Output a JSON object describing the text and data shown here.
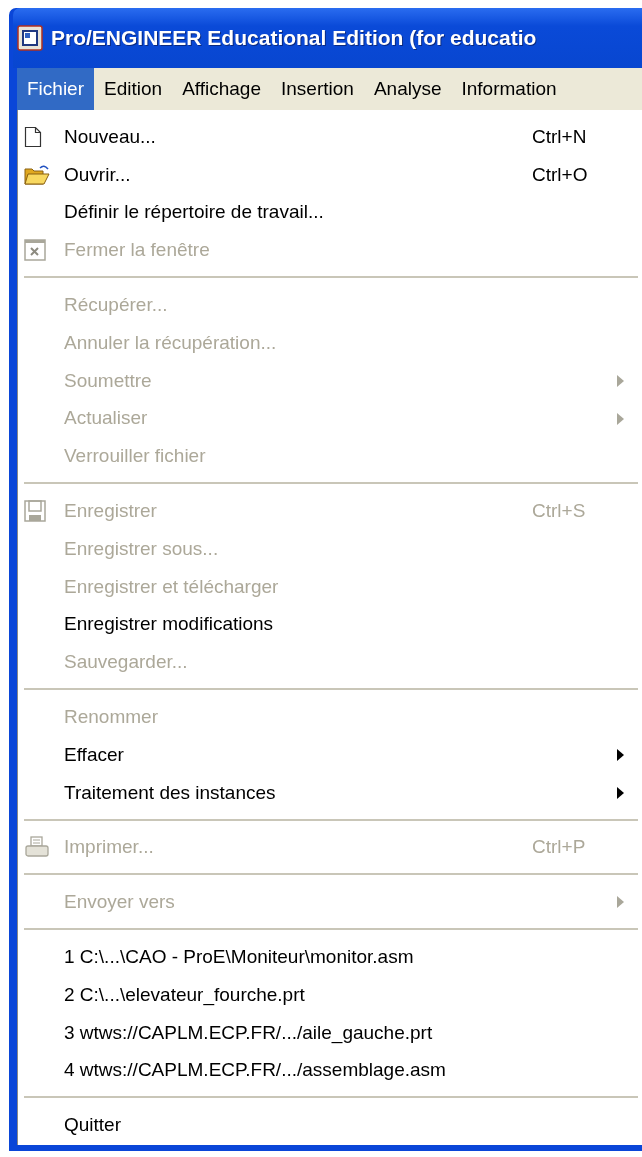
{
  "window": {
    "title": "Pro/ENGINEER Educational Edition (for educatio"
  },
  "menubar": [
    {
      "label": "Fichier",
      "selected": true
    },
    {
      "label": "Edition",
      "selected": false
    },
    {
      "label": "Affichage",
      "selected": false
    },
    {
      "label": "Insertion",
      "selected": false
    },
    {
      "label": "Analyse",
      "selected": false
    },
    {
      "label": "Information",
      "selected": false
    }
  ],
  "menu": [
    {
      "kind": "item",
      "label": "Nouveau...",
      "shortcut": "Ctrl+N",
      "disabled": false
    },
    {
      "kind": "item",
      "label": "Ouvrir...",
      "shortcut": "Ctrl+O",
      "disabled": false
    },
    {
      "kind": "item",
      "label": "Définir le répertoire de travail...",
      "disabled": false
    },
    {
      "kind": "item",
      "label": "Fermer la fenêtre",
      "disabled": true
    },
    {
      "kind": "separator"
    },
    {
      "kind": "item",
      "label": "Récupérer...",
      "disabled": true
    },
    {
      "kind": "item",
      "label": "Annuler la récupération...",
      "disabled": true
    },
    {
      "kind": "item",
      "label": "Soumettre",
      "disabled": true,
      "submenu": true
    },
    {
      "kind": "item",
      "label": "Actualiser",
      "disabled": true,
      "submenu": true
    },
    {
      "kind": "item",
      "label": "Verrouiller fichier",
      "disabled": true
    },
    {
      "kind": "separator"
    },
    {
      "kind": "item",
      "label": "Enregistrer",
      "shortcut": "Ctrl+S",
      "disabled": true
    },
    {
      "kind": "item",
      "label": "Enregistrer sous...",
      "disabled": true
    },
    {
      "kind": "item",
      "label": "Enregistrer et télécharger",
      "disabled": true
    },
    {
      "kind": "item",
      "label": "Enregistrer modifications",
      "disabled": false
    },
    {
      "kind": "item",
      "label": "Sauvegarder...",
      "disabled": true
    },
    {
      "kind": "separator"
    },
    {
      "kind": "item",
      "label": "Renommer",
      "disabled": true
    },
    {
      "kind": "item",
      "label": "Effacer",
      "disabled": false,
      "submenu": true
    },
    {
      "kind": "item",
      "label": "Traitement des instances",
      "disabled": false,
      "submenu": true
    },
    {
      "kind": "separator"
    },
    {
      "kind": "item",
      "label": "Imprimer...",
      "shortcut": "Ctrl+P",
      "disabled": true
    },
    {
      "kind": "separator"
    },
    {
      "kind": "item",
      "label": "Envoyer vers",
      "disabled": true,
      "submenu": true
    },
    {
      "kind": "separator"
    },
    {
      "kind": "item",
      "label": "1 C:\\...\\CAO - ProE\\Moniteur\\monitor.asm",
      "disabled": false
    },
    {
      "kind": "item",
      "label": "2 C:\\...\\elevateur_fourche.prt",
      "disabled": false
    },
    {
      "kind": "item",
      "label": "3 wtws://CAPLM.ECP.FR/.../aile_gauche.prt",
      "disabled": false
    },
    {
      "kind": "item",
      "label": "4 wtws://CAPLM.ECP.FR/.../assemblage.asm",
      "disabled": false
    },
    {
      "kind": "separator"
    },
    {
      "kind": "item",
      "label": "Quitter",
      "disabled": false
    }
  ]
}
